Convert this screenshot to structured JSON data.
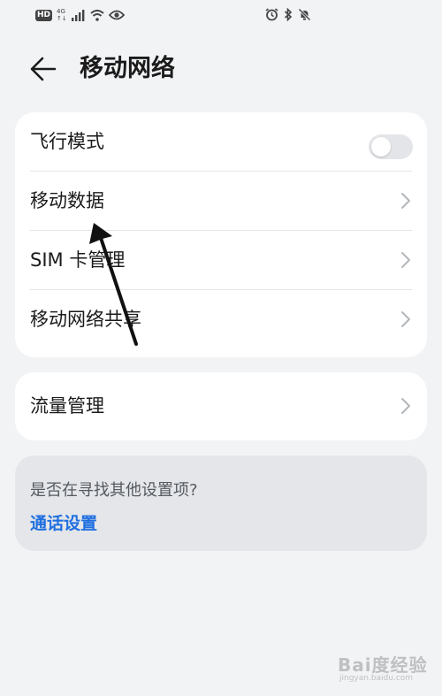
{
  "status_bar": {
    "hd_badge": "HD",
    "network_type": "4G",
    "network_sub": "↑↓"
  },
  "header": {
    "title": "移动网络"
  },
  "settings_card": {
    "items": [
      {
        "label": "飞行模式",
        "type": "toggle",
        "toggle_on": false
      },
      {
        "label": "移动数据",
        "type": "link"
      },
      {
        "label": "SIM 卡管理",
        "type": "link"
      },
      {
        "label": "移动网络共享",
        "type": "link"
      }
    ]
  },
  "traffic_card": {
    "label": "流量管理"
  },
  "suggestion": {
    "question": "是否在寻找其他设置项?",
    "link_label": "通话设置"
  },
  "watermark": {
    "main": "Bai度经验",
    "sub": "jingyan.baidu.com"
  },
  "colors": {
    "background": "#f1f3f5",
    "card": "#ffffff",
    "suggestion_bg": "#e4e6e9",
    "link": "#1f6fe0",
    "annotation_arrow": "#111111"
  },
  "icons": [
    "back-arrow-icon",
    "chevron-right-icon",
    "alarm-icon",
    "bluetooth-icon",
    "bell-muted-icon",
    "signal-icon",
    "wifi-icon",
    "eye-icon"
  ]
}
